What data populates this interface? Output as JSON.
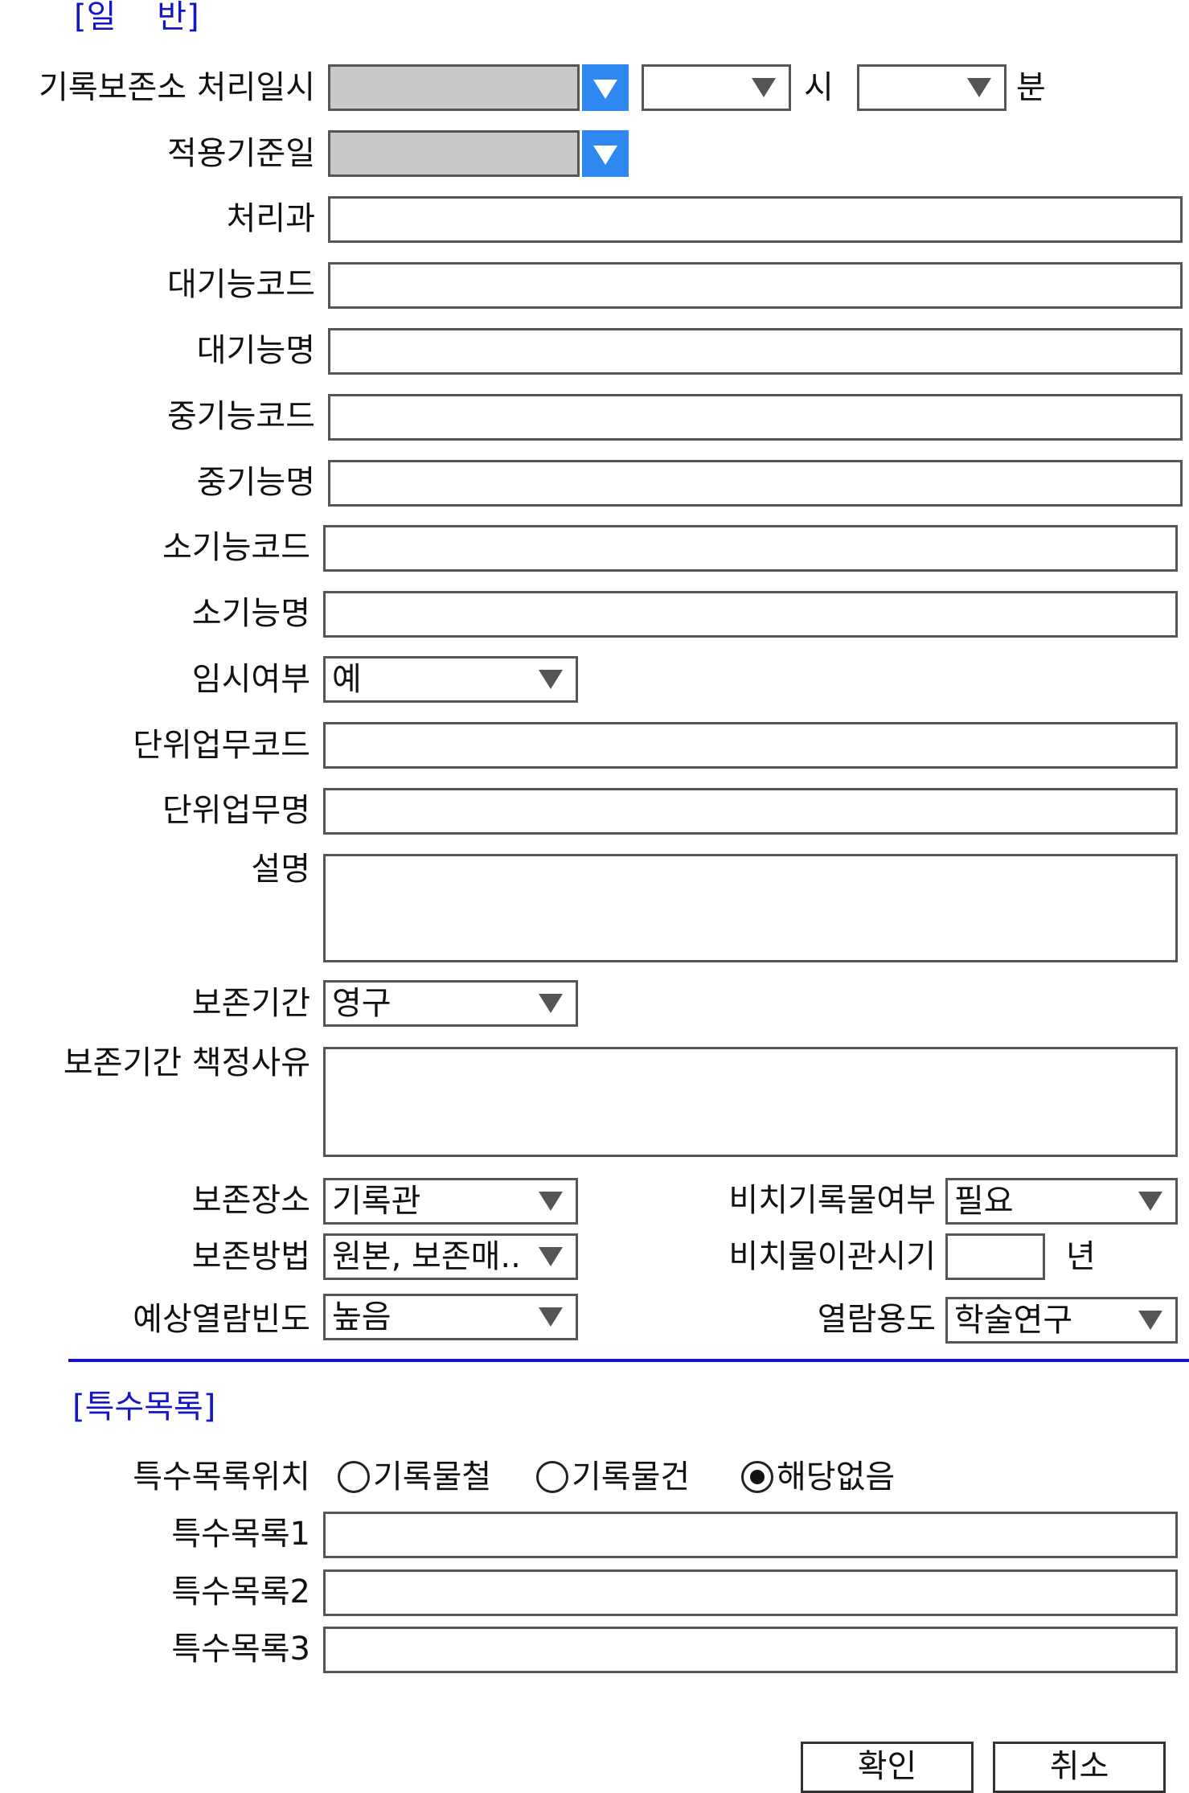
{
  "general": {
    "section_title": "[일    반]",
    "labels": {
      "processed_datetime": "기록보존소 처리일시",
      "reference_date": "적용기준일",
      "department": "처리과",
      "major_function_code": "대기능코드",
      "major_function_name": "대기능명",
      "mid_function_code": "중기능코드",
      "mid_function_name": "중기능명",
      "minor_function_code": "소기능코드",
      "minor_function_name": "소기능명",
      "temporary": "임시여부",
      "unit_task_code": "단위업무코드",
      "unit_task_name": "단위업무명",
      "description": "설명",
      "retention_period": "보존기간",
      "retention_reason": "보존기간 책정사유",
      "storage_location": "보존장소",
      "preservation_method": "보존방법",
      "expected_view_frequency": "예상열람빈도",
      "reference_required": "비치기록물여부",
      "reference_transfer": "비치물이관시기",
      "view_purpose": "열람용도"
    },
    "units": {
      "hour": "시",
      "minute": "분",
      "year": "년"
    },
    "values": {
      "processed_date": "",
      "hour": "",
      "minute": "",
      "reference_date": "",
      "department": "",
      "major_function_code": "",
      "major_function_name": "",
      "mid_function_code": "",
      "mid_function_name": "",
      "minor_function_code": "",
      "minor_function_name": "",
      "temporary": "예",
      "unit_task_code": "",
      "unit_task_name": "",
      "description": "",
      "retention_period": "영구",
      "retention_reason": "",
      "storage_location": "기록관",
      "preservation_method": "원본, 보존매..",
      "expected_view_frequency": "높음",
      "reference_required": "필요",
      "reference_transfer": "",
      "view_purpose": "학술연구"
    }
  },
  "special": {
    "section_title": "[특수목록]",
    "labels": {
      "location": "특수목록위치",
      "list1": "특수목록1",
      "list2": "특수목록2",
      "list3": "특수목록3"
    },
    "location_options": [
      {
        "label": "기록물철",
        "checked": false
      },
      {
        "label": "기록물건",
        "checked": false
      },
      {
        "label": "해당없음",
        "checked": true
      }
    ],
    "values": {
      "list1": "",
      "list2": "",
      "list3": ""
    }
  },
  "actions": {
    "confirm": "확인",
    "cancel": "취소"
  },
  "colors": {
    "section_title": "#1515c8",
    "divider": "#1515c8",
    "dropdown_button": "#2f87f0",
    "disabled_field": "#c9c9c9",
    "border": "#555555"
  },
  "icons": {
    "dropdown_button": "triangle-down-icon",
    "select_arrow": "triangle-down-icon",
    "radio_unchecked": "radio-empty-icon",
    "radio_checked": "radio-filled-icon"
  }
}
